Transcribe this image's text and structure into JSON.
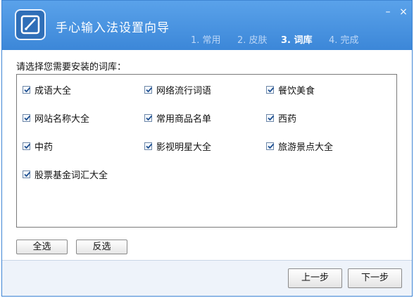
{
  "window": {
    "title": "手心输入法设置向导",
    "minimize_glyph": "–",
    "close_glyph": "×"
  },
  "steps": [
    {
      "label": "1. 常用",
      "active": false
    },
    {
      "label": "2. 皮肤",
      "active": false
    },
    {
      "label": "3. 词库",
      "active": true
    },
    {
      "label": "4. 完成",
      "active": false
    }
  ],
  "prompt": "请选择您需要安装的词库：",
  "dictionaries": [
    {
      "label": "成语大全",
      "checked": true
    },
    {
      "label": "网络流行词语",
      "checked": true
    },
    {
      "label": "餐饮美食",
      "checked": true
    },
    {
      "label": "网站名称大全",
      "checked": true
    },
    {
      "label": "常用商品名单",
      "checked": true
    },
    {
      "label": "西药",
      "checked": true
    },
    {
      "label": "中药",
      "checked": true
    },
    {
      "label": "影视明星大全",
      "checked": true
    },
    {
      "label": "旅游景点大全",
      "checked": true
    },
    {
      "label": "股票基金词汇大全",
      "checked": true
    }
  ],
  "buttons": {
    "select_all": "全选",
    "invert": "反选",
    "prev": "上一步",
    "next": "下一步"
  },
  "icons": {
    "logo": "input-method-logo-icon",
    "check": "checkmark-icon"
  }
}
